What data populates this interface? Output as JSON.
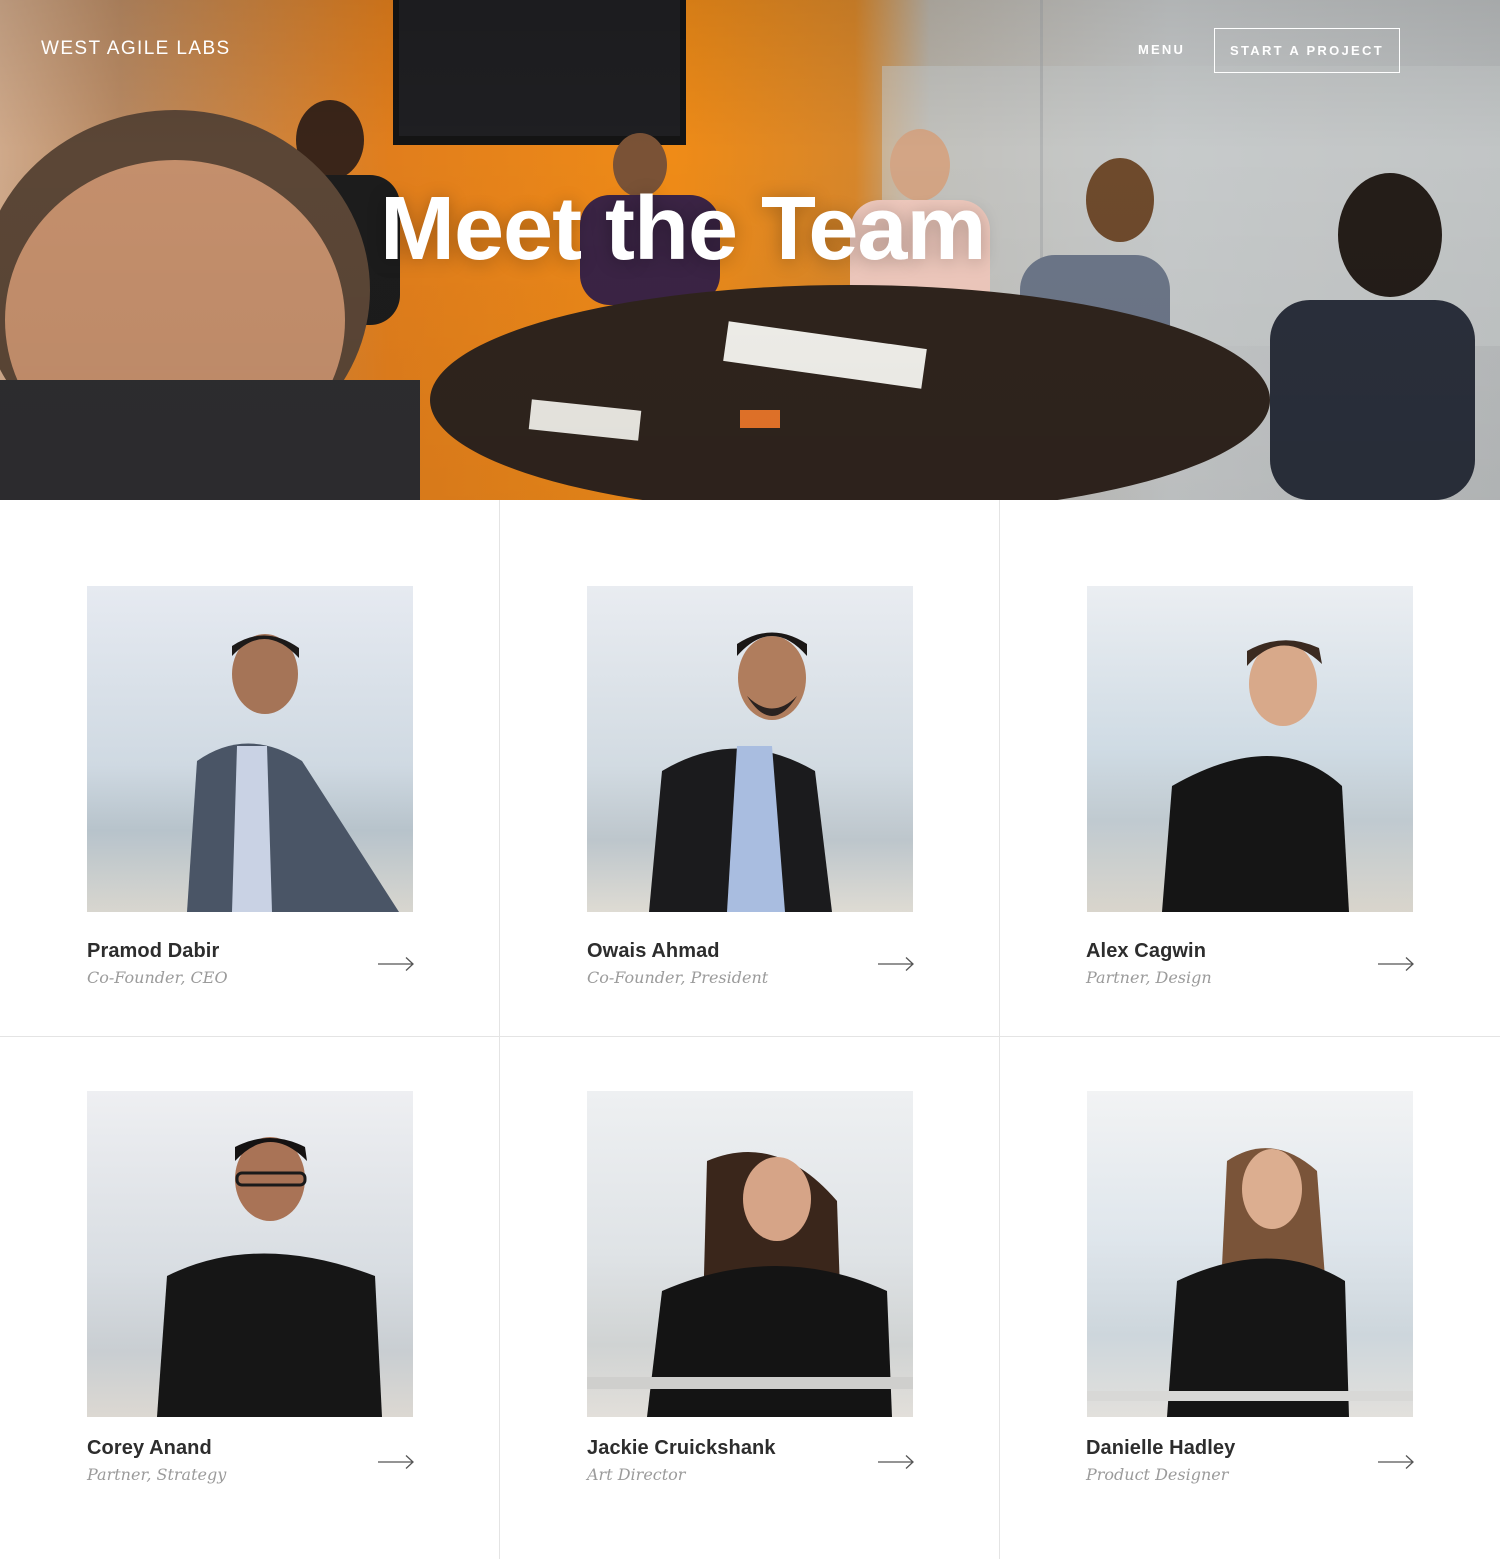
{
  "header": {
    "brand": "WEST AGILE LABS",
    "menu_label": "MENU",
    "cta_label": "START A PROJECT"
  },
  "hero": {
    "title": "Meet the Team"
  },
  "team": [
    {
      "name": "Pramod Dabir",
      "role": "Co-Founder, CEO"
    },
    {
      "name": "Owais Ahmad",
      "role": "Co-Founder, President"
    },
    {
      "name": "Alex Cagwin",
      "role": "Partner, Design"
    },
    {
      "name": "Corey Anand",
      "role": "Partner, Strategy"
    },
    {
      "name": "Jackie Cruickshank",
      "role": "Art Director"
    },
    {
      "name": "Danielle Hadley",
      "role": "Product Designer"
    }
  ],
  "icons": {
    "card_link": "arrow-right-icon"
  },
  "colors": {
    "accent_orange": "#ef8b17",
    "text_dark": "#2d2d2d",
    "text_muted": "#9b9b9b",
    "divider": "#e4e4e4"
  }
}
